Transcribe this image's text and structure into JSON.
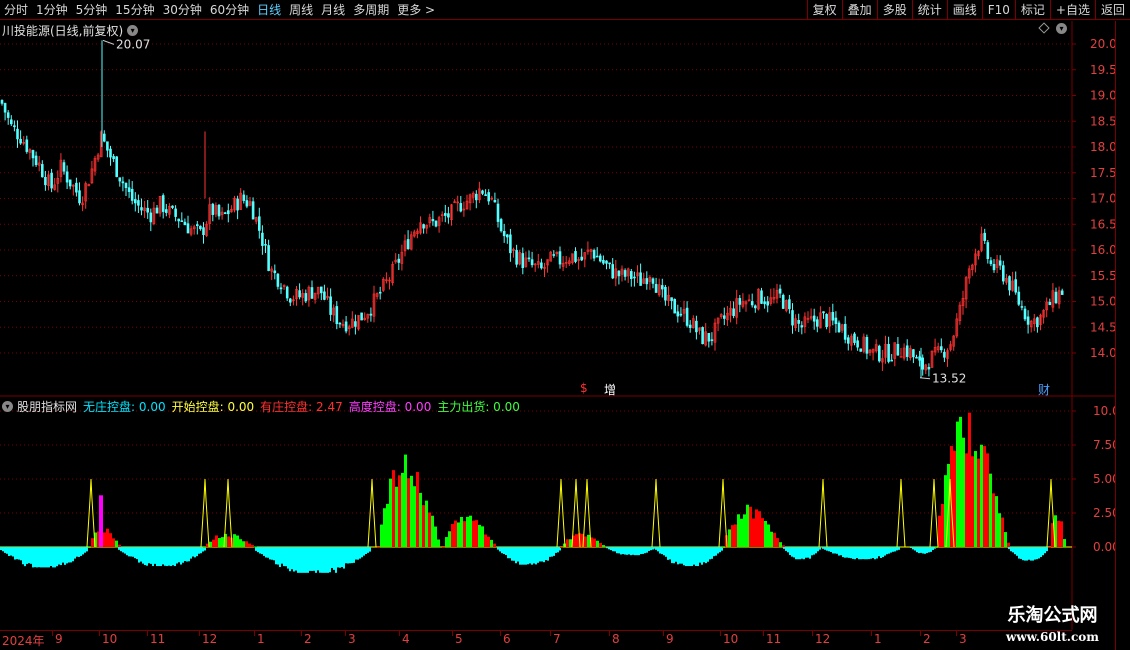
{
  "toolbar": {
    "periods": [
      {
        "label": "分时",
        "active": false
      },
      {
        "label": "1分钟",
        "active": false
      },
      {
        "label": "5分钟",
        "active": false
      },
      {
        "label": "15分钟",
        "active": false
      },
      {
        "label": "30分钟",
        "active": false
      },
      {
        "label": "60分钟",
        "active": false
      },
      {
        "label": "日线",
        "active": true
      },
      {
        "label": "周线",
        "active": false
      },
      {
        "label": "月线",
        "active": false
      },
      {
        "label": "多周期",
        "active": false
      },
      {
        "label": "更多 >",
        "active": false
      }
    ],
    "buttons": [
      "复权",
      "叠加",
      "多股",
      "统计",
      "画线",
      "F10",
      "标记",
      "+自选",
      "返回"
    ]
  },
  "price_chart": {
    "title": "川投能源(日线,前复权)",
    "high_label": "20.07",
    "low_label": "13.52",
    "y_ticks": [
      "20.00",
      "19.50",
      "19.00",
      "18.50",
      "18.00",
      "17.50",
      "17.00",
      "16.50",
      "16.00",
      "15.50",
      "15.00",
      "14.50",
      "14.00"
    ]
  },
  "markers": {
    "dollar": "$",
    "zeng": "增",
    "cai": "财"
  },
  "indicator": {
    "name": "股朋指标网",
    "items": [
      {
        "label": "无庄控盘:",
        "value": "0.00",
        "color": "#00e5ff"
      },
      {
        "label": "开始控盘:",
        "value": "0.00",
        "color": "#ffff40"
      },
      {
        "label": "有庄控盘:",
        "value": "2.47",
        "color": "#ff3030"
      },
      {
        "label": "高度控盘:",
        "value": "0.00",
        "color": "#ff40ff"
      },
      {
        "label": "主力出货:",
        "value": "0.00",
        "color": "#40ff40"
      }
    ],
    "y_ticks": [
      "10.00",
      "7.50",
      "5.00",
      "2.50",
      "0.00"
    ]
  },
  "date_axis": {
    "labels": [
      "2024年",
      "9",
      "10",
      "11",
      "12",
      "1",
      "2",
      "3",
      "4",
      "5",
      "6",
      "7",
      "8",
      "9",
      "10",
      "11",
      "12",
      "1",
      "2",
      "3"
    ]
  },
  "watermark": {
    "line1": "乐淘公式网",
    "line2": "www.60lt.com"
  },
  "colors": {
    "up": "#ff3232",
    "down": "#54ffff",
    "grid": "#7a0000",
    "axis_label": "#e04040",
    "cyan_bar": "#00ffff",
    "red_bar": "#ff0000",
    "green_bar": "#00ff00",
    "magenta_bar": "#ff00ff",
    "yellow_line": "#ffff00"
  },
  "chart_data": {
    "type": "candlestick+histogram",
    "price_range": [
      13.52,
      20.07
    ],
    "indicator_range": [
      -3.5,
      10.0
    ],
    "price_path": [
      [
        0,
        18.9
      ],
      [
        10,
        18.4
      ],
      [
        20,
        18.2
      ],
      [
        30,
        17.9
      ],
      [
        40,
        17.6
      ],
      [
        50,
        17.2
      ],
      [
        60,
        17.6
      ],
      [
        70,
        17.3
      ],
      [
        80,
        17.0
      ],
      [
        90,
        17.5
      ],
      [
        100,
        18.2
      ],
      [
        110,
        17.8
      ],
      [
        120,
        17.4
      ],
      [
        130,
        17.0
      ],
      [
        140,
        16.8
      ],
      [
        150,
        16.7
      ],
      [
        160,
        16.9
      ],
      [
        170,
        16.7
      ],
      [
        180,
        16.6
      ],
      [
        190,
        16.4
      ],
      [
        200,
        16.3
      ],
      [
        210,
        16.8
      ],
      [
        220,
        16.6
      ],
      [
        230,
        16.8
      ],
      [
        240,
        17.0
      ],
      [
        250,
        16.9
      ],
      [
        260,
        16.3
      ],
      [
        270,
        15.6
      ],
      [
        280,
        15.4
      ],
      [
        290,
        15.1
      ],
      [
        300,
        15.1
      ],
      [
        310,
        15.2
      ],
      [
        320,
        15.2
      ],
      [
        330,
        14.8
      ],
      [
        340,
        14.6
      ],
      [
        350,
        14.6
      ],
      [
        360,
        14.7
      ],
      [
        370,
        14.9
      ],
      [
        380,
        15.2
      ],
      [
        390,
        15.5
      ],
      [
        400,
        15.9
      ],
      [
        410,
        16.3
      ],
      [
        420,
        16.6
      ],
      [
        430,
        16.5
      ],
      [
        440,
        16.6
      ],
      [
        450,
        16.7
      ],
      [
        460,
        16.9
      ],
      [
        470,
        17.0
      ],
      [
        480,
        17.2
      ],
      [
        490,
        17.0
      ],
      [
        500,
        16.4
      ],
      [
        510,
        16.0
      ],
      [
        520,
        15.8
      ],
      [
        530,
        15.7
      ],
      [
        540,
        15.6
      ],
      [
        550,
        15.8
      ],
      [
        560,
        15.8
      ],
      [
        570,
        15.9
      ],
      [
        580,
        15.8
      ],
      [
        590,
        16.0
      ],
      [
        600,
        15.8
      ],
      [
        610,
        15.6
      ],
      [
        620,
        15.5
      ],
      [
        630,
        15.5
      ],
      [
        640,
        15.4
      ],
      [
        650,
        15.6
      ],
      [
        660,
        15.1
      ],
      [
        670,
        14.9
      ],
      [
        680,
        14.8
      ],
      [
        690,
        14.6
      ],
      [
        700,
        14.3
      ],
      [
        710,
        14.3
      ],
      [
        720,
        14.6
      ],
      [
        730,
        14.8
      ],
      [
        740,
        15.0
      ],
      [
        750,
        15.0
      ],
      [
        760,
        15.1
      ],
      [
        770,
        15.0
      ],
      [
        780,
        15.1
      ],
      [
        790,
        14.7
      ],
      [
        800,
        14.5
      ],
      [
        810,
        14.6
      ],
      [
        820,
        14.7
      ],
      [
        830,
        14.6
      ],
      [
        840,
        14.5
      ],
      [
        850,
        14.3
      ],
      [
        860,
        14.2
      ],
      [
        870,
        14.0
      ],
      [
        880,
        14.0
      ],
      [
        890,
        14.0
      ],
      [
        900,
        14.1
      ],
      [
        910,
        14.0
      ],
      [
        920,
        13.7
      ],
      [
        930,
        13.9
      ],
      [
        940,
        14.0
      ],
      [
        950,
        14.2
      ],
      [
        960,
        14.9
      ],
      [
        970,
        15.8
      ],
      [
        980,
        16.2
      ],
      [
        990,
        15.7
      ],
      [
        1000,
        15.6
      ],
      [
        1010,
        15.3
      ],
      [
        1020,
        14.9
      ],
      [
        1030,
        14.6
      ],
      [
        1040,
        14.7
      ],
      [
        1050,
        15.0
      ],
      [
        1060,
        15.2
      ]
    ],
    "histogram_negative_segments": [
      {
        "x": [
          0,
          88
        ],
        "min": -1.5
      },
      {
        "x": [
          118,
          205
        ],
        "min": -1.4
      },
      {
        "x": [
          255,
          370
        ],
        "min": -1.9
      },
      {
        "x": [
          497,
          560
        ],
        "min": -1.3
      },
      {
        "x": [
          606,
          655
        ],
        "min": -0.6
      },
      {
        "x": [
          655,
          722
        ],
        "min": -1.4
      },
      {
        "x": [
          783,
          820
        ],
        "min": -0.9
      },
      {
        "x": [
          822,
          900
        ],
        "min": -0.9
      },
      {
        "x": [
          910,
          935
        ],
        "min": -0.5
      },
      {
        "x": [
          1008,
          1048
        ],
        "min": -1.0
      }
    ],
    "histogram_positive_segments": [
      {
        "x": [
          88,
          120
        ],
        "max": 1.5,
        "color": "mixed"
      },
      {
        "x": [
          203,
          255
        ],
        "max": 1.0,
        "color": "mixed"
      },
      {
        "x": [
          377,
          440
        ],
        "max": 6.5,
        "color": "mixed"
      },
      {
        "x": [
          442,
          495
        ],
        "max": 2.5,
        "color": "mixed"
      },
      {
        "x": [
          560,
          605
        ],
        "max": 1.0,
        "color": "mixed"
      },
      {
        "x": [
          722,
          783
        ],
        "max": 3.0,
        "color": "mixed"
      },
      {
        "x": [
          935,
          1008
        ],
        "max": 9.7,
        "color": "mixed"
      },
      {
        "x": [
          1048,
          1065
        ],
        "max": 2.6,
        "color": "mixed"
      }
    ],
    "yellow_spikes": [
      91,
      205,
      228,
      372,
      561,
      576,
      587,
      656,
      723,
      823,
      901,
      934,
      950,
      1051
    ]
  }
}
